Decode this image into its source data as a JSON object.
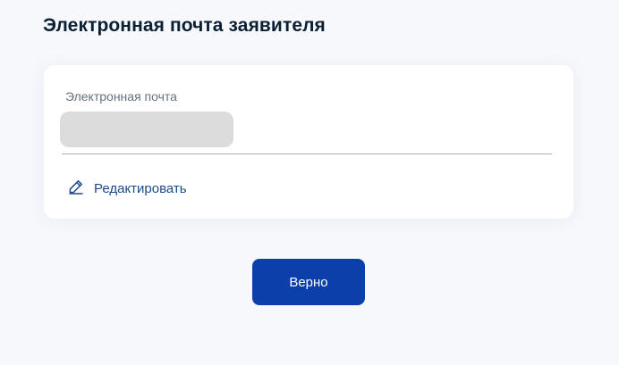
{
  "page": {
    "title": "Электронная почта заявителя"
  },
  "email_card": {
    "field_label": "Электронная почта",
    "field_value": "",
    "edit_label": "Редактировать",
    "edit_icon": "pencil-icon"
  },
  "actions": {
    "confirm_label": "Верно"
  },
  "colors": {
    "accent": "#0d3fab",
    "link": "#1d4a8c",
    "title": "#0b1f33",
    "background": "#f6f8fc"
  }
}
